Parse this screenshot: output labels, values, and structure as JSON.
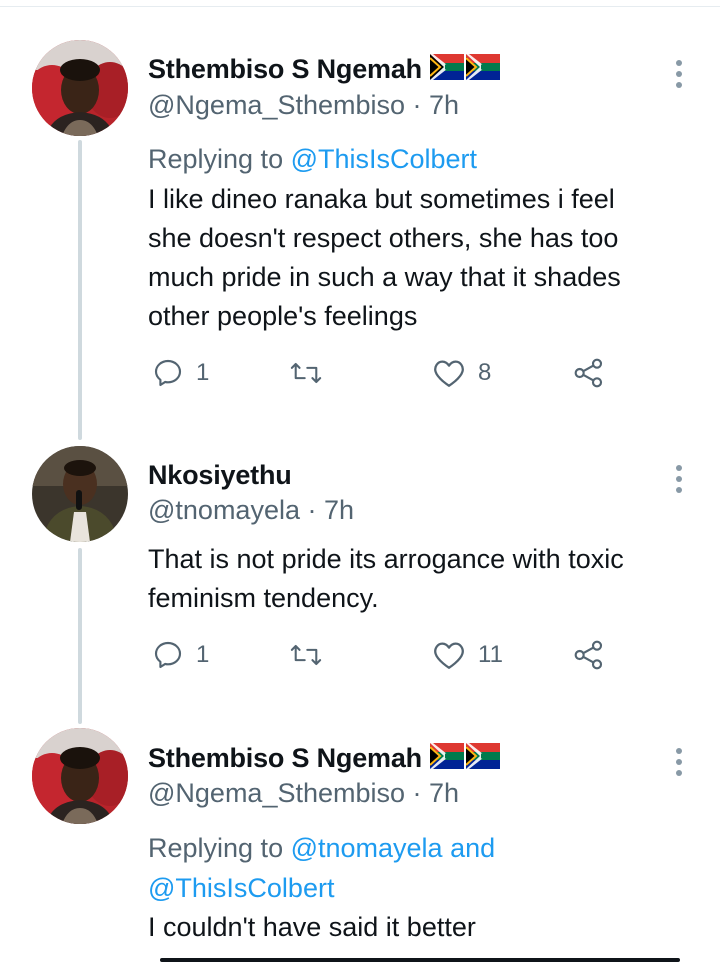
{
  "tweets": [
    {
      "name": "Sthembiso S Ngemah",
      "handle": "@Ngema_Sthembiso",
      "time": "· 7h",
      "replying_prefix": "Replying to ",
      "replying_mentions": "@ThisIsColbert",
      "replying_line2": "",
      "text_lines": [
        "I like dineo ranaka but sometimes i feel",
        "she doesn't respect others, she has too",
        "much pride in such a way that it shades",
        "other people's feelings"
      ],
      "replies": "1",
      "retweets": "",
      "likes": "8",
      "flags": 2
    },
    {
      "name": "Nkosiyethu",
      "handle": "@tnomayela",
      "time": "· 7h",
      "text_lines": [
        "That is not pride its arrogance with toxic",
        "feminism tendency."
      ],
      "replies": "1",
      "retweets": "",
      "likes": "11",
      "flags": 0
    },
    {
      "name": "Sthembiso S Ngemah",
      "handle": "@Ngema_Sthembiso",
      "time": "· 7h",
      "replying_prefix": "Replying to ",
      "replying_mentions": "@tnomayela and",
      "replying_line2": "@ThisIsColbert",
      "text_lines": [
        "I couldn't have said it better"
      ],
      "flags": 2
    }
  ],
  "icons": {
    "reply": "reply-icon",
    "retweet": "retweet-icon",
    "like": "heart-icon",
    "share": "share-icon",
    "more": "more-vertical-icon",
    "flag": "south-africa-flag-icon"
  },
  "colors": {
    "link": "#1d9bf0",
    "secondary": "#536471",
    "thread_line": "#cfd9de"
  }
}
